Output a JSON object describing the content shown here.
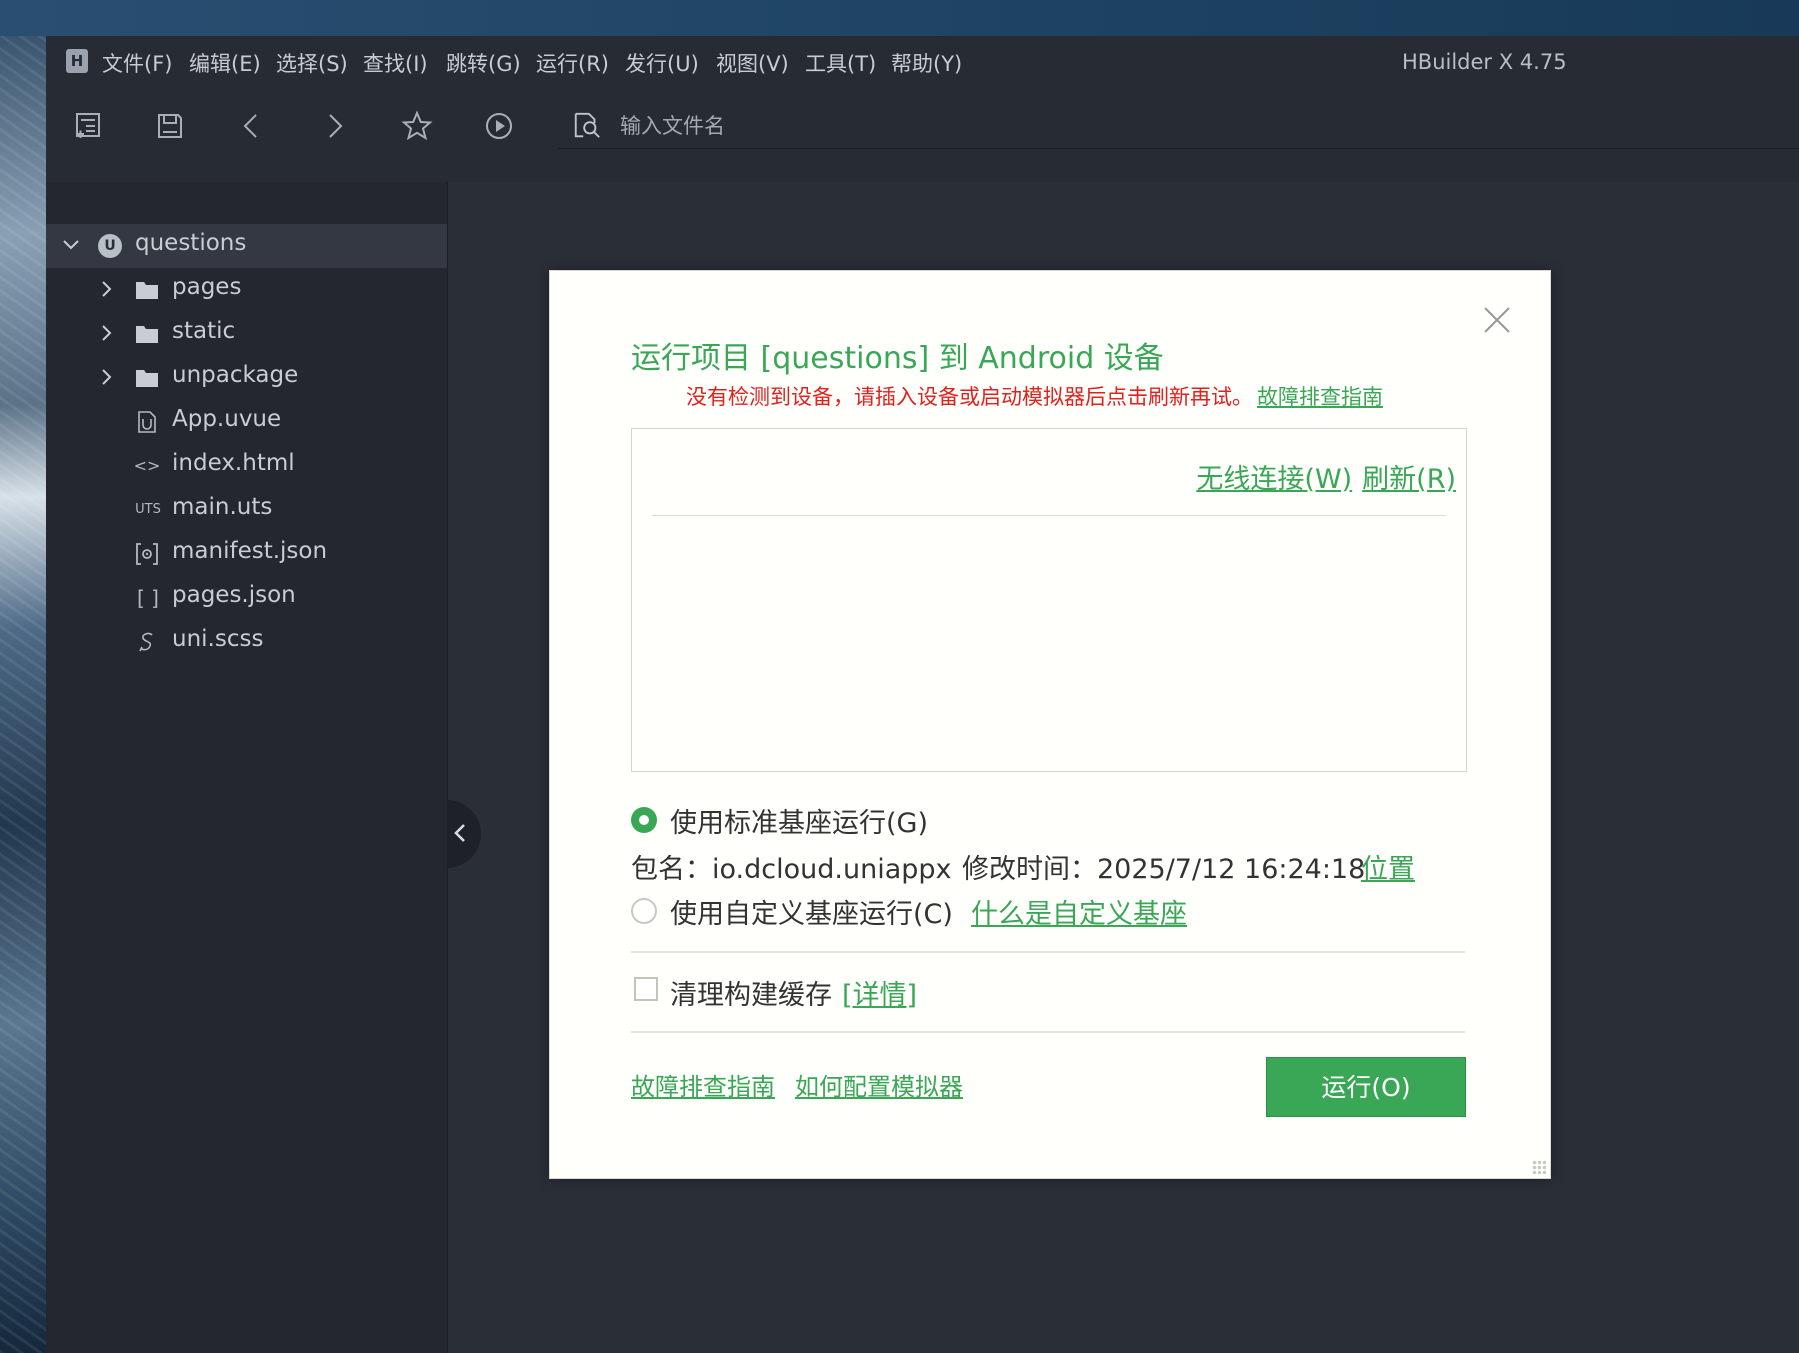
{
  "app": {
    "title": "HBuilder X 4.75",
    "menu": [
      "文件(F)",
      "编辑(E)",
      "选择(S)",
      "查找(I)",
      "跳转(G)",
      "运行(R)",
      "发行(U)",
      "视图(V)",
      "工具(T)",
      "帮助(Y)"
    ]
  },
  "toolbar": {
    "search_placeholder": "输入文件名",
    "icons": [
      "new-file-icon",
      "save-icon",
      "back-icon",
      "forward-icon",
      "star-icon",
      "run-icon",
      "file-search-icon"
    ]
  },
  "sidebar": {
    "project": "questions",
    "items": [
      {
        "label": "pages",
        "type": "folder"
      },
      {
        "label": "static",
        "type": "folder"
      },
      {
        "label": "unpackage",
        "type": "folder"
      },
      {
        "label": "App.uvue",
        "type": "uvue"
      },
      {
        "label": "index.html",
        "type": "html"
      },
      {
        "label": "main.uts",
        "type": "uts"
      },
      {
        "label": "manifest.json",
        "type": "manifest"
      },
      {
        "label": "pages.json",
        "type": "json"
      },
      {
        "label": "uni.scss",
        "type": "scss"
      }
    ],
    "file_badges": {
      "html": "<>",
      "uts": "UTS",
      "json": "[ ]"
    }
  },
  "dialog": {
    "title": "运行项目 [questions] 到 Android 设备",
    "warning": "没有检测到设备，请插入设备或启动模拟器后点击刷新再试。",
    "warning_link": "故障排查指南",
    "wireless_label": "无线连接(W)",
    "refresh_label": "刷新(R)",
    "option_standard": "使用标准基座运行(G)",
    "package_label": "包名：io.dcloud.uniappx",
    "modified_label": "修改时间：2025/7/12 16:24:18",
    "location_link": "位置",
    "option_custom": "使用自定义基座运行(C)",
    "custom_link": "什么是自定义基座",
    "clear_cache_label": "清理构建缓存",
    "details_link": "[详情]",
    "troubleshoot_link": "故障排查指南",
    "emulator_link": "如何配置模拟器",
    "run_button": "运行(O)",
    "standard_selected": true,
    "clear_cache_checked": false
  },
  "colors": {
    "accent": "#3aa757",
    "warning": "#e0211c",
    "sidebar_bg": "#24272f",
    "editor_bg": "#2a2e37"
  }
}
